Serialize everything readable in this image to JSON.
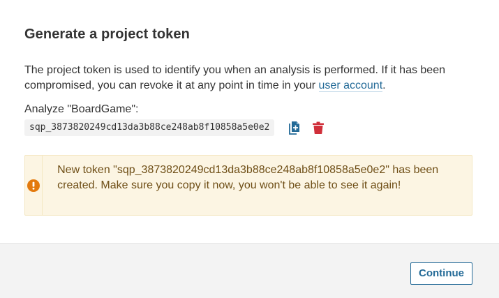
{
  "modal": {
    "title": "Generate a project token",
    "description_text": "The project token is used to identify you when an analysis is performed. If it has been compromised, you can revoke it at any point in time in your ",
    "description_link": "user account",
    "description_end": ".",
    "analyze_label": "Analyze \"BoardGame\":",
    "token": "sqp_3873820249cd13da3b88ce248ab8f10858a5e0e2",
    "copy_icon": "copy-icon",
    "delete_icon": "trash-icon",
    "alert": {
      "icon": "exclamation-circle-icon",
      "text": "New token \"sqp_3873820249cd13da3b88ce248ab8f10858a5e0e2\" has been created. Make sure you copy it now, you won't be able to see it again!"
    },
    "footer": {
      "continue_label": "Continue"
    }
  },
  "colors": {
    "link": "#236a97",
    "delete": "#d02f3a",
    "warning_icon": "#e37a0e",
    "alert_bg": "#fcf5e3",
    "alert_text": "#6f4f17",
    "footer_bg": "#f3f3f3"
  }
}
